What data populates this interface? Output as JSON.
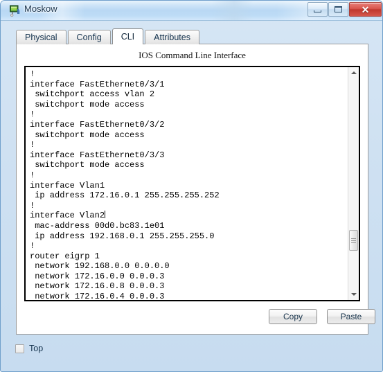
{
  "window": {
    "title": "Moskow",
    "icon": "device-node-icon",
    "controls": [
      {
        "name": "minimize-button",
        "label": "–"
      },
      {
        "name": "maximize-button",
        "label": "□"
      },
      {
        "name": "close-button",
        "label": "✕"
      }
    ]
  },
  "tabs": [
    {
      "label": "Physical",
      "active": false
    },
    {
      "label": "Config",
      "active": false
    },
    {
      "label": "CLI",
      "active": true
    },
    {
      "label": "Attributes",
      "active": false
    }
  ],
  "panel": {
    "title": "IOS Command Line Interface"
  },
  "terminal": {
    "lines": [
      "!",
      "interface FastEthernet0/3/1",
      " switchport access vlan 2",
      " switchport mode access",
      "!",
      "interface FastEthernet0/3/2",
      " switchport mode access",
      "!",
      "interface FastEthernet0/3/3",
      " switchport mode access",
      "!",
      "interface Vlan1",
      " ip address 172.16.0.1 255.255.255.252",
      "!",
      "interface Vlan2",
      " mac-address 00d0.bc83.1e01",
      " ip address 192.168.0.1 255.255.255.0",
      "!",
      "router eigrp 1",
      " network 192.168.0.0 0.0.0.0",
      " network 172.16.0.0 0.0.0.3",
      " network 172.16.0.8 0.0.0.3",
      " network 172.16.0.4 0.0.0.3"
    ],
    "caret_line_index": 14,
    "text_color": "#000000",
    "background_color": "#ffffff"
  },
  "scrollbar": {
    "up_arrow": "scroll-up-arrow",
    "down_arrow": "scroll-down-arrow",
    "thumb_top_percent": 80
  },
  "buttons": {
    "copy": "Copy",
    "paste": "Paste"
  },
  "checkbox": {
    "label": "Top",
    "checked": false
  },
  "colors": {
    "titlebar_accent": "#b9d8f4",
    "close_button": "#c0372e",
    "window_border": "#6f9fcb",
    "panel_background": "#ffffff"
  }
}
